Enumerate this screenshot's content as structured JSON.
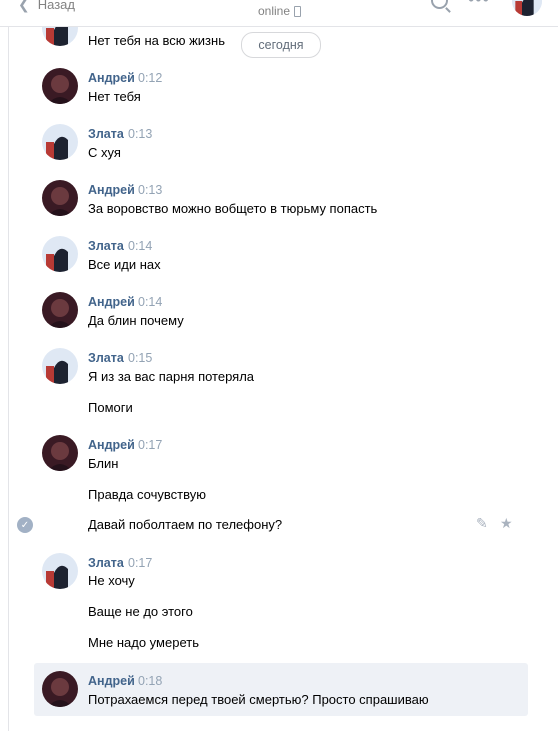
{
  "header": {
    "back_label": "Назад",
    "status": "online"
  },
  "date_separator": "сегодня",
  "messages": [
    {
      "author": "",
      "time": "0:12",
      "lines": [
        "Нет тебя на всю жизнь"
      ]
    },
    {
      "author": "Андрей",
      "time": "0:12",
      "lines": [
        "Нет тебя"
      ]
    },
    {
      "author": "Злата",
      "time": "0:13",
      "lines": [
        "С хуя"
      ]
    },
    {
      "author": "Андрей",
      "time": "0:13",
      "lines": [
        "За воровство можно вобщето в тюрьму попасть"
      ]
    },
    {
      "author": "Злата",
      "time": "0:14",
      "lines": [
        "Все иди нах"
      ]
    },
    {
      "author": "Андрей",
      "time": "0:14",
      "lines": [
        "Да блин почему"
      ]
    },
    {
      "author": "Злата",
      "time": "0:15",
      "lines": [
        "Я из за вас парня потеряла",
        "Помоги"
      ]
    },
    {
      "author": "Андрей",
      "time": "0:17",
      "lines": [
        "Блин",
        "Правда сочувствую",
        "Давай поболтаем по телефону?"
      ]
    },
    {
      "author": "Злата",
      "time": "0:17",
      "lines": [
        "Не хочу",
        "Ваще не до этого",
        "Мне надо умереть"
      ]
    },
    {
      "author": "Андрей",
      "time": "0:18",
      "lines": [
        "Потрахаемся перед твоей смертью? Просто спрашиваю"
      ]
    }
  ],
  "icons": {
    "back": "chevron-left-icon",
    "phone": "phone-icon",
    "search": "search-icon",
    "more": "more-icon",
    "read": "check-icon",
    "edit": "pencil-icon",
    "favorite": "star-icon"
  },
  "colors": {
    "author_name": "#42648b",
    "time": "#93a3b4",
    "selected_bg": "#eef1f6"
  }
}
